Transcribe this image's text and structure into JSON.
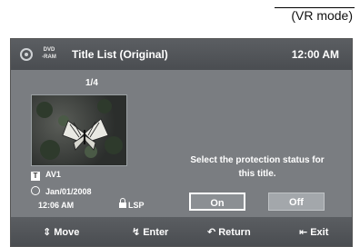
{
  "mode_label": "(VR mode)",
  "header": {
    "disc_type": "DVD\n-RAM",
    "disc_icon": "disc-icon",
    "title": "Title List (Original)",
    "clock": "12:00 AM"
  },
  "list": {
    "page_indicator": "1/4",
    "thumbnail_icon": "butterfly-image"
  },
  "info": {
    "source_icon": "source-t-icon",
    "source": "AV1",
    "date_icon": "clock-icon",
    "date": "Jan/01/2008",
    "time": "12:06 AM",
    "protect_icon": "unlock-icon",
    "record_mode": "LSP"
  },
  "dialog": {
    "prompt": "Select the protection status for this title.",
    "on_label": "On",
    "off_label": "Off",
    "selected": "On"
  },
  "footer": {
    "move_label": "Move",
    "enter_label": "Enter",
    "return_label": "Return",
    "exit_label": "Exit",
    "move_icon": "updown-arrows-icon",
    "enter_icon": "enter-icon",
    "return_icon": "return-icon",
    "exit_icon": "exit-icon"
  },
  "colors": {
    "panel": "#7a7d81",
    "bar": "#4f5256",
    "text": "#ffffff"
  }
}
